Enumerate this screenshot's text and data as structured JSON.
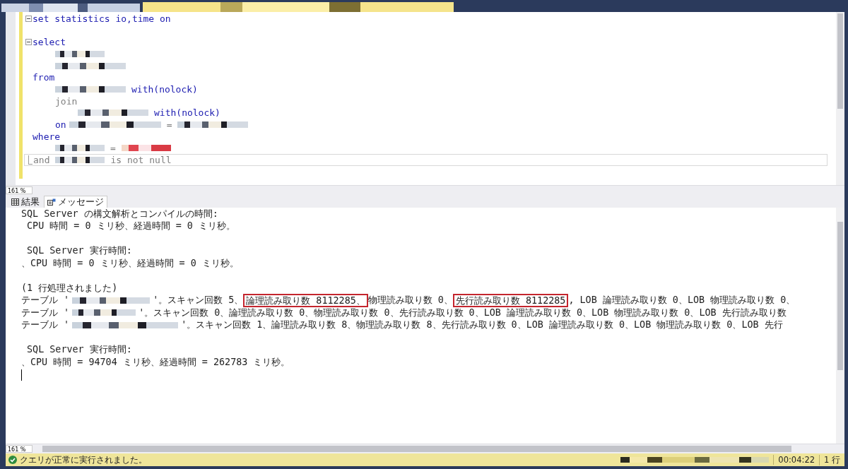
{
  "document_tabs": [
    {
      "selected": false
    },
    {
      "selected": true
    }
  ],
  "editor": {
    "lines": [
      {
        "kind": "top",
        "collapsible": true,
        "fold_end": false,
        "current": false,
        "segments": [
          {
            "kind": "keyword",
            "text": "set statistics io,time on"
          }
        ]
      },
      {
        "kind": "top",
        "collapsible": false,
        "fold_end": false,
        "current": false
      },
      {
        "kind": "top",
        "collapsible": true,
        "fold_end": false,
        "current": false,
        "segments": [
          {
            "kind": "keyword",
            "text": "select"
          }
        ]
      },
      {
        "kind": "inner",
        "collapsible": false,
        "fold_end": false,
        "current": false,
        "segments": [
          {
            "kind": "redacted_short"
          }
        ]
      },
      {
        "kind": "inner",
        "collapsible": false,
        "fold_end": false,
        "current": false,
        "segments": [
          {
            "kind": "redacted_medium"
          }
        ]
      },
      {
        "kind": "top",
        "collapsible": false,
        "fold_end": false,
        "current": false,
        "segments": [
          {
            "kind": "keyword",
            "text": "from"
          }
        ]
      },
      {
        "kind": "inner",
        "collapsible": false,
        "fold_end": false,
        "current": false,
        "segments": [
          {
            "kind": "redacted_medium"
          },
          {
            "kind": "keyword",
            "text": "with(nolock)"
          }
        ]
      },
      {
        "kind": "inner",
        "collapsible": false,
        "fold_end": false,
        "current": false,
        "segments": [
          {
            "kind": "gray",
            "text": "join"
          }
        ]
      },
      {
        "kind": "deep",
        "collapsible": false,
        "fold_end": false,
        "current": false,
        "segments": [
          {
            "kind": "redacted_medium"
          },
          {
            "kind": "keyword",
            "text": "with(nolock)"
          }
        ]
      },
      {
        "kind": "inner",
        "collapsible": false,
        "fold_end": false,
        "current": false,
        "segments": [
          {
            "kind": "keyword",
            "text": "on"
          },
          {
            "kind": "redacted_long"
          },
          {
            "kind": "gray",
            "text": "="
          },
          {
            "kind": "redacted_medium"
          }
        ]
      },
      {
        "kind": "top",
        "collapsible": false,
        "fold_end": false,
        "current": false,
        "segments": [
          {
            "kind": "keyword",
            "text": "where"
          }
        ]
      },
      {
        "kind": "inner",
        "collapsible": false,
        "fold_end": false,
        "current": false,
        "segments": [
          {
            "kind": "redacted_short"
          },
          {
            "kind": "gray",
            "text": "="
          },
          {
            "kind": "redacted_string"
          }
        ]
      },
      {
        "kind": "top",
        "collapsible": false,
        "fold_end": true,
        "current": true,
        "segments": [
          {
            "kind": "gray",
            "text": "and"
          },
          {
            "kind": "redacted_short"
          },
          {
            "kind": "gray",
            "text": "is not null"
          }
        ]
      }
    ]
  },
  "editor_zoom": "161 %",
  "result_tabs": [
    {
      "kind": "grid",
      "label": "結果",
      "selected": false
    },
    {
      "kind": "messages",
      "label": "メッセージ",
      "selected": true
    }
  ],
  "messages": [
    {
      "spaced": false,
      "segments": [
        {
          "kind": "text",
          "text": "SQL Server の構文解析とコンパイルの時間:"
        }
      ]
    },
    {
      "spaced": false,
      "segments": [
        {
          "kind": "text",
          "text": " CPU 時間 = 0 ミリ秒、経過時間 = 0 ミリ秒。"
        }
      ]
    },
    {
      "spaced": true,
      "segments": [
        {
          "kind": "text",
          "text": " SQL Server 実行時間:"
        }
      ]
    },
    {
      "spaced": false,
      "segments": [
        {
          "kind": "text",
          "text": "、CPU 時間 = 0 ミリ秒、経過時間 = 0 ミリ秒。"
        }
      ]
    },
    {
      "spaced": true,
      "segments": [
        {
          "kind": "text",
          "text": "(1 行処理されました)"
        }
      ]
    },
    {
      "spaced": false,
      "segments": [
        {
          "kind": "text",
          "text": "テーブル '"
        },
        {
          "kind": "redacted_long"
        },
        {
          "kind": "text",
          "text": "'。スキャン回数 5、"
        },
        {
          "kind": "boxed",
          "text": "論理読み取り数 8112285、"
        },
        {
          "kind": "text",
          "text": "物理読み取り数 0、"
        },
        {
          "kind": "boxed",
          "text": "先行読み取り数 8112285"
        },
        {
          "kind": "text",
          "text": ", LOB 論理読み取り数 0、LOB 物理読み取り数 0、"
        }
      ]
    },
    {
      "spaced": false,
      "segments": [
        {
          "kind": "text",
          "text": "テーブル '"
        },
        {
          "kind": "redacted_medium"
        },
        {
          "kind": "text",
          "text": "'。スキャン回数 0、論理読み取り数 0、物理読み取り数 0、先行読み取り数 0、LOB 論理読み取り数 0、LOB 物理読み取り数 0、LOB 先行読み取り数"
        }
      ]
    },
    {
      "spaced": false,
      "segments": [
        {
          "kind": "text",
          "text": "テーブル '"
        },
        {
          "kind": "redacted_xlong"
        },
        {
          "kind": "text",
          "text": "'。スキャン回数 1、論理読み取り数 8、物理読み取り数 8、先行読み取り数 0、LOB 論理読み取り数 0、LOB 物理読み取り数 0、LOB 先行"
        }
      ]
    },
    {
      "spaced": true,
      "segments": [
        {
          "kind": "text",
          "text": " SQL Server 実行時間:"
        }
      ]
    },
    {
      "spaced": false,
      "segments": [
        {
          "kind": "text",
          "text": "、CPU 時間 = 94704 ミリ秒、経過時間 = 262783 ミリ秒。"
        }
      ]
    }
  ],
  "results_zoom": "161 %",
  "status_bar": {
    "message": "クエリが正常に実行されました。",
    "elapsed": "00:04:22",
    "rows": "1 行"
  }
}
